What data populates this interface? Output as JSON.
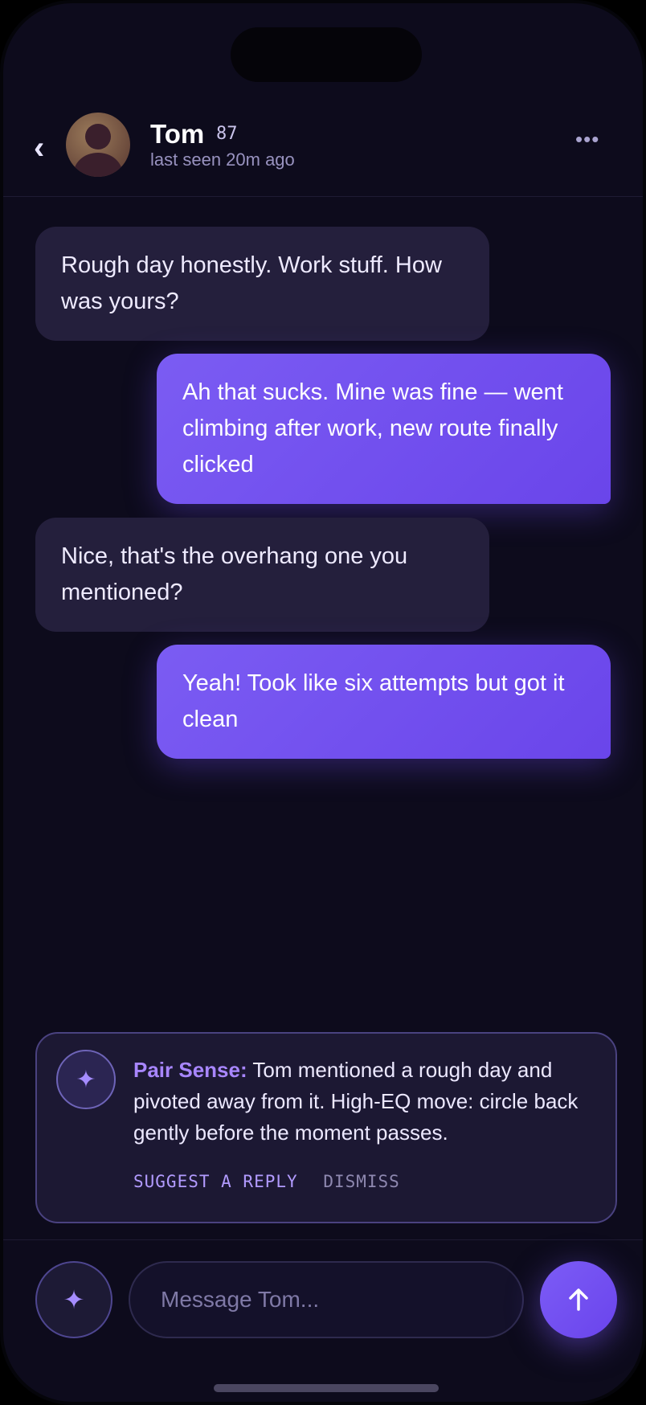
{
  "contact": {
    "name": "Tom",
    "score": "87",
    "status": "last seen 20m ago"
  },
  "messages": [
    {
      "from": "them",
      "text": "Rough day honestly. Work stuff. How was yours?"
    },
    {
      "from": "me",
      "text": "Ah that sucks. Mine was fine — went climbing after work, new route finally clicked"
    },
    {
      "from": "them",
      "text": "Nice, that's the overhang one you mentioned?"
    },
    {
      "from": "me",
      "text": "Yeah! Took like six attempts but got it clean"
    }
  ],
  "pair_sense": {
    "title": "Pair Sense:",
    "body": " Tom mentioned a rough day and pivoted away from it. High-EQ move: circle back gently before the moment passes.",
    "suggest_label": "SUGGEST A REPLY",
    "dismiss_label": "DISMISS"
  },
  "composer": {
    "placeholder": "Message Tom..."
  },
  "icons": {
    "back": "chevron-left-icon",
    "more": "ellipsis-icon",
    "sparkle": "sparkle-icon",
    "send": "arrow-up-icon"
  },
  "colors": {
    "background": "#0d0b1c",
    "accent": "#7b5cf3",
    "incoming_bubble": "#241f3c"
  }
}
